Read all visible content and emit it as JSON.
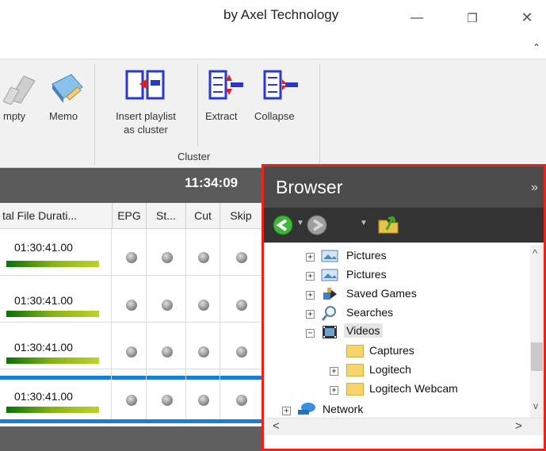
{
  "window": {
    "title": "by Axel Technology",
    "minimize_glyph": "—",
    "maximize_glyph": "❐",
    "close_glyph": "✕",
    "collapse_ribbon_glyph": "⌃"
  },
  "ribbon": {
    "empty_label": "mpty",
    "memo_label": "Memo",
    "insert_playlist_line1": "Insert playlist",
    "insert_playlist_line2": "as cluster",
    "extract_label": "Extract",
    "collapse_label": "Collapse",
    "group_label": "Cluster"
  },
  "grid": {
    "clock": "11:34:09",
    "columns": [
      "tal File Durati...",
      "EPG",
      "St...",
      "Cut",
      "Skip"
    ],
    "rows": [
      {
        "duration": "01:30:41.00"
      },
      {
        "duration": "01:30:41.00"
      },
      {
        "duration": "01:30:41.00"
      },
      {
        "duration": "01:30:41.00"
      }
    ]
  },
  "browser": {
    "title": "Browser",
    "more_glyph": "»",
    "tree": [
      {
        "label": "Pictures",
        "expander": "+"
      },
      {
        "label": "Pictures",
        "expander": "+"
      },
      {
        "label": "Saved Games",
        "expander": "+"
      },
      {
        "label": "Searches",
        "expander": "+"
      },
      {
        "label": "Videos",
        "expander": "−"
      },
      {
        "label": "Captures",
        "expander": ""
      },
      {
        "label": "Logitech",
        "expander": "+"
      },
      {
        "label": "Logitech Webcam",
        "expander": "+"
      },
      {
        "label": "Network",
        "expander": "+"
      }
    ],
    "scroll_up": "^",
    "scroll_down": "v",
    "scroll_left": "<",
    "scroll_right": ">"
  },
  "colors": {
    "highlight_border": "#e8231d",
    "selection_line": "#1a7fd4",
    "panel_header": "#4b4b4b"
  }
}
